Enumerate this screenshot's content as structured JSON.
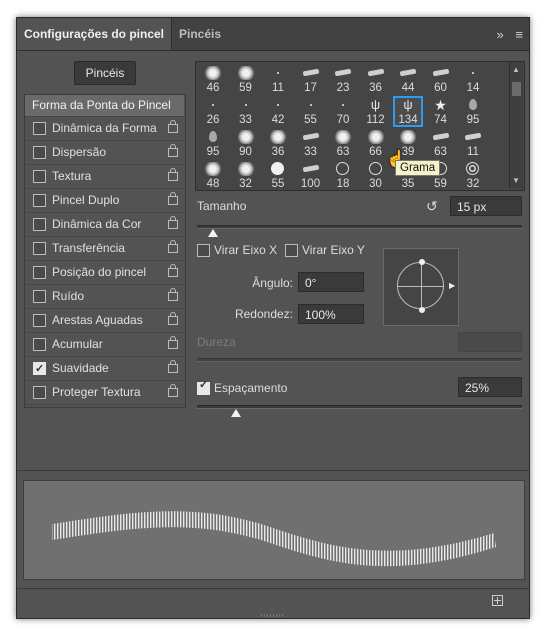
{
  "tabs": [
    {
      "label": "Configurações do pincel",
      "active": true
    },
    {
      "label": "Pincéis",
      "active": false
    }
  ],
  "toolbar": {
    "collapse_icon": "double-chevron-right-icon",
    "menu_icon": "panel-menu-icon"
  },
  "brushes_button": "Pincéis",
  "left_panel": {
    "tip_shape": "Forma da Ponta do Pincel",
    "options": [
      {
        "label": "Dinâmica da Forma",
        "checked": false
      },
      {
        "label": "Dispersão",
        "checked": false
      },
      {
        "label": "Textura",
        "checked": false
      },
      {
        "label": "Pincel Duplo",
        "checked": false
      },
      {
        "label": "Dinâmica da Cor",
        "checked": false
      },
      {
        "label": "Transferência",
        "checked": false
      },
      {
        "label": "Posição do pincel",
        "checked": false
      },
      {
        "label": "Ruído",
        "checked": false
      },
      {
        "label": "Arestas Aguadas",
        "checked": false
      },
      {
        "label": "Acumular",
        "checked": false
      },
      {
        "label": "Suavidade",
        "checked": true
      },
      {
        "label": "Proteger Textura",
        "checked": false
      }
    ]
  },
  "brush_grid": {
    "rows": [
      [
        "46",
        "59",
        "11",
        "17",
        "23",
        "36",
        "44",
        "60",
        "14"
      ],
      [
        "26",
        "33",
        "42",
        "55",
        "70",
        "112",
        "134",
        "74",
        "95"
      ],
      [
        "95",
        "90",
        "36",
        "33",
        "63",
        "66",
        "39",
        "63",
        "11"
      ],
      [
        "48",
        "32",
        "55",
        "100",
        "18",
        "30",
        "35",
        "59",
        "32"
      ]
    ],
    "selected": "134",
    "tooltip": "Grama"
  },
  "size": {
    "label": "Tamanho",
    "value": "15 px",
    "reset_icon": "reset-size-icon",
    "level": 0.05
  },
  "flip": {
    "x_label": "Virar Eixo X",
    "y_label": "Virar Eixo Y",
    "x_checked": false,
    "y_checked": false
  },
  "angle": {
    "label": "Ângulo:",
    "value": "0°"
  },
  "roundness": {
    "label": "Redondez:",
    "value": "100%"
  },
  "hardness": {
    "label": "Dureza",
    "value": ""
  },
  "spacing": {
    "label": "Espaçamento",
    "checked": true,
    "value": "25%",
    "level": 0.12
  },
  "colors": {
    "accent": "#2d9bf0",
    "panel": "#535353",
    "tab_bar": "#424242"
  }
}
